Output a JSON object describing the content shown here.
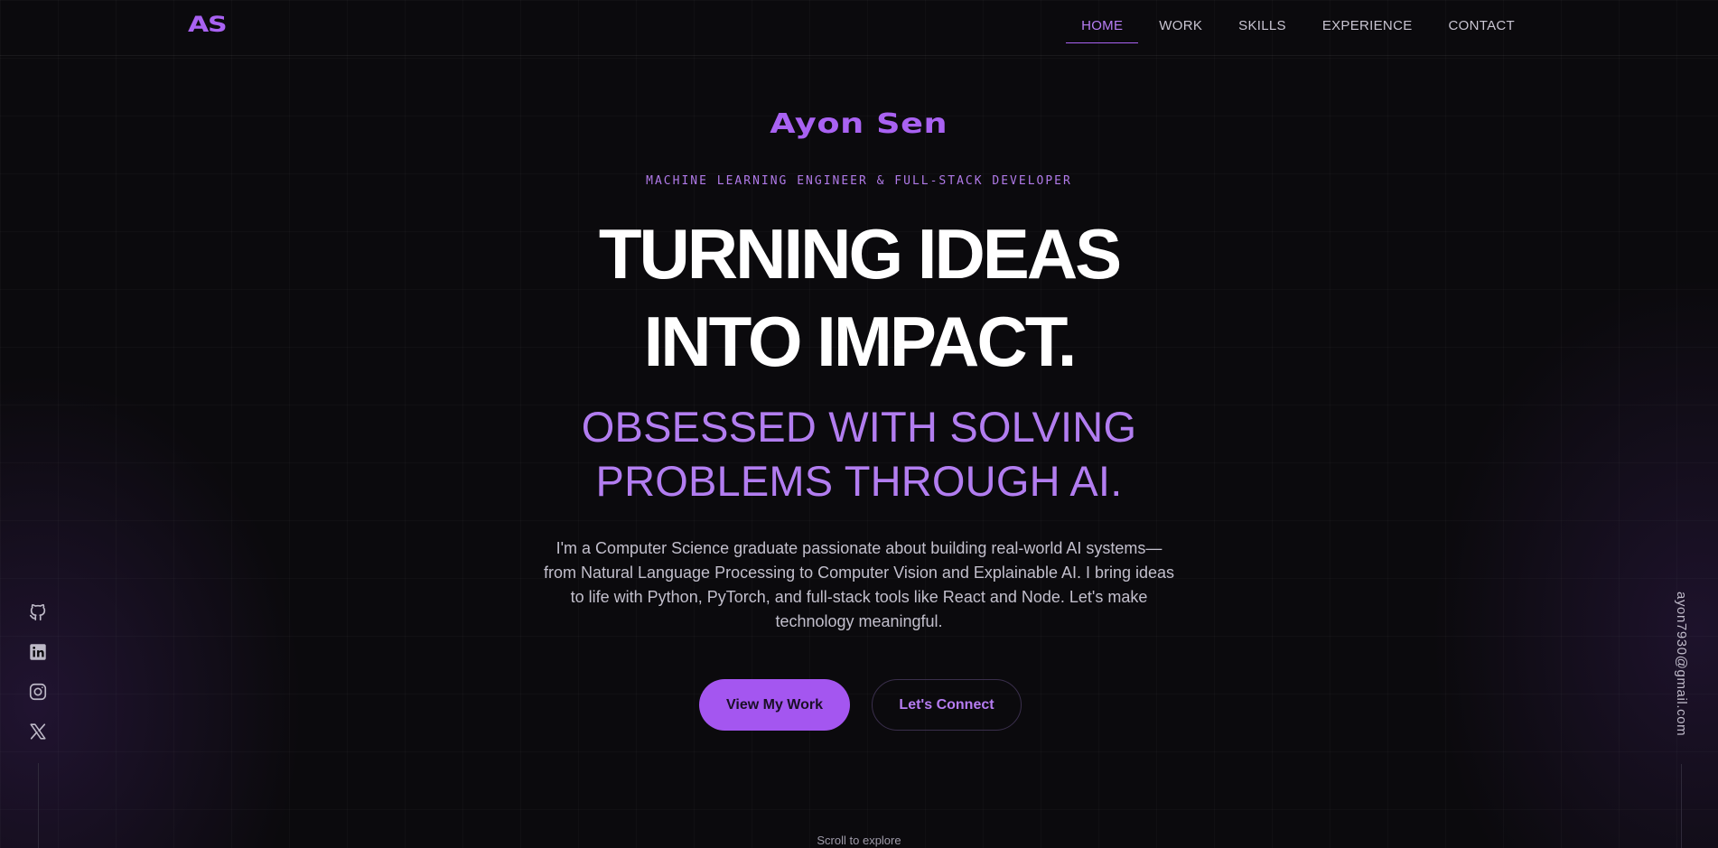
{
  "brand": {
    "logo": "AS"
  },
  "nav": {
    "items": [
      {
        "label": "HOME",
        "active": true
      },
      {
        "label": "WORK",
        "active": false
      },
      {
        "label": "SKILLS",
        "active": false
      },
      {
        "label": "EXPERIENCE",
        "active": false
      },
      {
        "label": "CONTACT",
        "active": false
      }
    ]
  },
  "hero": {
    "name": "Ayon Sen",
    "subtitle": "MACHINE LEARNING ENGINEER & FULL-STACK DEVELOPER",
    "headline_line1": "TURNING IDEAS",
    "headline_line2": "INTO IMPACT.",
    "subheadline_line1": "OBSESSED WITH SOLVING",
    "subheadline_line2": "PROBLEMS THROUGH AI.",
    "bio": "I'm a Computer Science graduate passionate about building real-world AI systems— from Natural Language Processing to Computer Vision and Explainable AI. I bring ideas to life with Python, PyTorch, and full-stack tools like React and Node. Let's make technology meaningful.",
    "primary_button": "View My Work",
    "secondary_button": "Let's Connect",
    "scroll_hint": "Scroll to explore"
  },
  "social": {
    "icons": [
      "github-icon",
      "linkedin-icon",
      "instagram-icon",
      "x-icon"
    ]
  },
  "contact": {
    "email": "ayon7930@gmail.com"
  },
  "colors": {
    "accent": "#a962f2",
    "background": "#0b0a0d",
    "text": "#ffffff",
    "muted": "#c2bfcc"
  }
}
